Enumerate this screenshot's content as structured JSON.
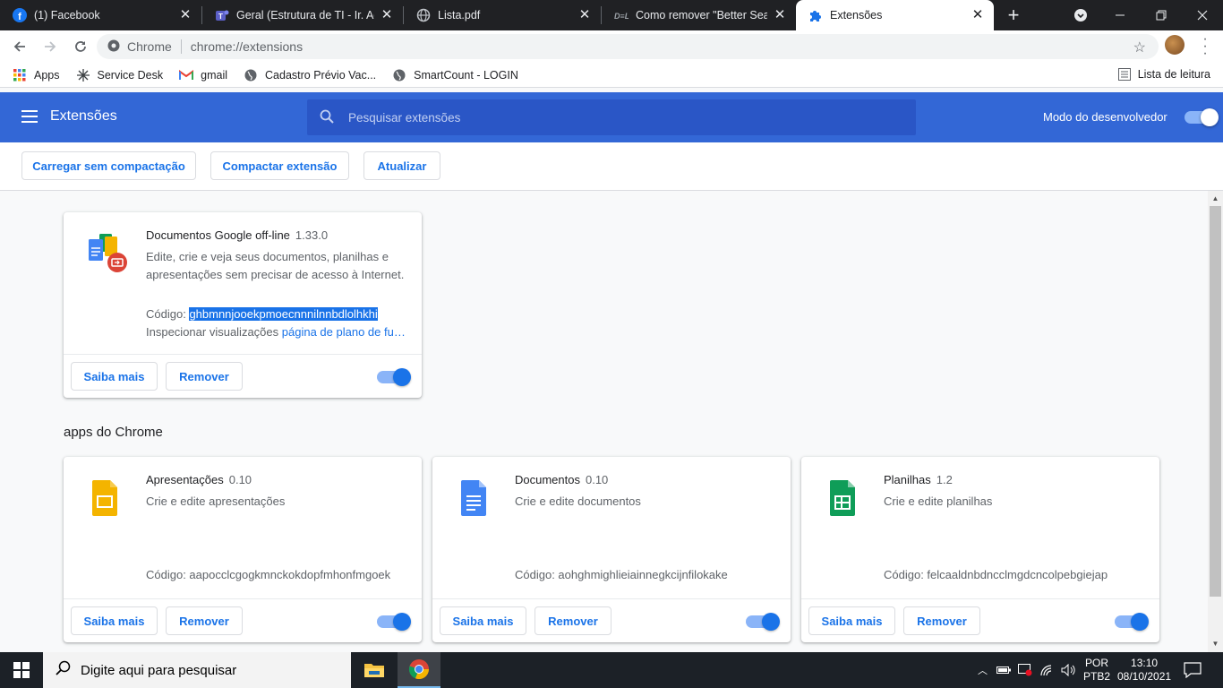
{
  "browser": {
    "tabs": [
      {
        "title": "(1) Facebook",
        "icon": "facebook-icon"
      },
      {
        "title": "Geral (Estrutura de TI - Ir. Acá",
        "icon": "teams-icon"
      },
      {
        "title": "Lista.pdf",
        "icon": "globe-icon"
      },
      {
        "title": "Como remover \"Better Search",
        "icon": "dell-icon"
      },
      {
        "title": "Extensões",
        "icon": "puzzle-icon",
        "active": true
      }
    ],
    "omnibox": {
      "site_label": "Chrome",
      "url": "chrome://extensions"
    },
    "bookmarks": [
      {
        "label": "Apps",
        "icon": "apps-grid-icon"
      },
      {
        "label": "Service Desk",
        "icon": "service-desk-icon"
      },
      {
        "label": "gmail",
        "icon": "gmail-icon"
      },
      {
        "label": "Cadastro Prévio Vac...",
        "icon": "globe-icon"
      },
      {
        "label": "SmartCount - LOGIN",
        "icon": "globe-icon"
      }
    ],
    "reading_list": "Lista de leitura"
  },
  "extensions_page": {
    "title": "Extensões",
    "search_placeholder": "Pesquisar extensões",
    "developer_mode_label": "Modo do desenvolvedor",
    "developer_mode_on": true,
    "actions": {
      "load_unpacked": "Carregar sem compactação",
      "pack": "Compactar extensão",
      "update": "Atualizar"
    },
    "extension": {
      "name": "Documentos Google off-line",
      "version": "1.33.0",
      "description": "Edite, crie e veja seus documentos, planilhas e apresentações sem precisar de acesso à Internet.",
      "code_label": "Código:",
      "code": "ghbmnnjooekpmoecnnnilnnbdlolhkhi",
      "inspect_label": "Inspecionar visualizações",
      "inspect_link": "página de plano de fu…",
      "details_label": "Saiba mais",
      "remove_label": "Remover",
      "enabled": true
    },
    "apps_section_title": "apps do Chrome",
    "apps": [
      {
        "name": "Apresentações",
        "version": "0.10",
        "description": "Crie e edite apresentações",
        "code": "Código: aapocclcgogkmnckokdopfmhonfmgoek",
        "details_label": "Saiba mais",
        "remove_label": "Remover",
        "enabled": true,
        "icon": "slides-icon",
        "color": "#f4b400"
      },
      {
        "name": "Documentos",
        "version": "0.10",
        "description": "Crie e edite documentos",
        "code": "Código: aohghmighlieiainnegkcijnfilokake",
        "details_label": "Saiba mais",
        "remove_label": "Remover",
        "enabled": true,
        "icon": "docs-icon",
        "color": "#4285f4"
      },
      {
        "name": "Planilhas",
        "version": "1.2",
        "description": "Crie e edite planilhas",
        "code": "Código: felcaaldnbdncclmgdcncolpebgiejap",
        "details_label": "Saiba mais",
        "remove_label": "Remover",
        "enabled": true,
        "icon": "sheets-icon",
        "color": "#0f9d58"
      }
    ]
  },
  "taskbar": {
    "search_placeholder": "Digite aqui para pesquisar",
    "language": "POR",
    "keyboard": "PTB2",
    "time": "13:10",
    "date": "08/10/2021"
  },
  "colors": {
    "accent": "#3367d6",
    "link": "#1a73e8",
    "toggle_on": "#1a73e8"
  }
}
